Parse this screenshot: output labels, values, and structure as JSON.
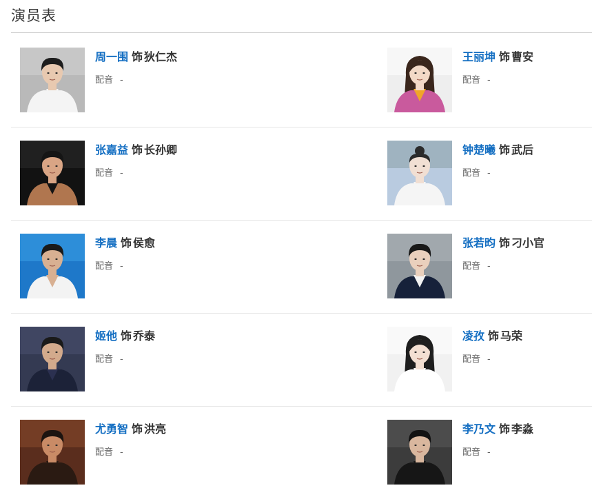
{
  "section": {
    "title": "演员表"
  },
  "cast": [
    {
      "actor": "周一围",
      "connector": "饰",
      "role": "狄仁杰",
      "voice_label": "配音",
      "voice_value": "-",
      "photo": {
        "bg": "#b9b9b9",
        "bg2": "#d3d3d3",
        "skin": "#e8c9b0",
        "hair": "#1d1d1d",
        "outfit": "#f4f4f4",
        "shirt": "#f4f4f4",
        "hair_style": "short"
      }
    },
    {
      "actor": "王丽坤",
      "connector": "饰",
      "role": "曹安",
      "voice_label": "配音",
      "voice_value": "-",
      "photo": {
        "bg": "#eeeeee",
        "bg2": "#ffffff",
        "skin": "#f3d9c7",
        "hair": "#3a261c",
        "outfit": "#c95a9d",
        "shirt": "#f0a52a",
        "hair_style": "long"
      }
    },
    {
      "actor": "张嘉益",
      "connector": "饰",
      "role": "长孙卿",
      "voice_label": "配音",
      "voice_value": "-",
      "photo": {
        "bg": "#121212",
        "bg2": "#2b2b2b",
        "skin": "#d9a585",
        "hair": "#151515",
        "outfit": "#b0764f",
        "shirt": "#141414",
        "hair_style": "short"
      }
    },
    {
      "actor": "钟楚曦",
      "connector": "饰",
      "role": "武后",
      "voice_label": "配音",
      "voice_value": "-",
      "photo": {
        "bg": "#b9cbe0",
        "bg2": "#8aa1a6",
        "skin": "#f1dfd3",
        "hair": "#2b2b2b",
        "outfit": "#f5f5f5",
        "shirt": "#f5f5f5",
        "hair_style": "bun"
      }
    },
    {
      "actor": "李晨",
      "connector": "饰",
      "role": "侯愈",
      "voice_label": "配音",
      "voice_value": "-",
      "photo": {
        "bg": "#1e78c9",
        "bg2": "#3aa0e6",
        "skin": "#d8b092",
        "hair": "#1a1a1a",
        "outfit": "#f3f3f3",
        "shirt": "#d8b092",
        "hair_style": "short"
      }
    },
    {
      "actor": "张若昀",
      "connector": "饰",
      "role": "刁小官",
      "voice_label": "配音",
      "voice_value": "-",
      "photo": {
        "bg": "#8f979d",
        "bg2": "#b0b6ba",
        "skin": "#ead0bd",
        "hair": "#191919",
        "outfit": "#16213a",
        "shirt": "#f3f3f3",
        "hair_style": "short"
      }
    },
    {
      "actor": "姬他",
      "connector": "饰",
      "role": "乔泰",
      "voice_label": "配音",
      "voice_value": "-",
      "photo": {
        "bg": "#343a52",
        "bg2": "#4a5070",
        "skin": "#d3aa8c",
        "hair": "#1a1a1a",
        "outfit": "#1c2238",
        "shirt": "#2b3050",
        "hair_style": "short"
      }
    },
    {
      "actor": "凌孜",
      "connector": "饰",
      "role": "马荣",
      "voice_label": "配音",
      "voice_value": "-",
      "photo": {
        "bg": "#f1f1f1",
        "bg2": "#ffffff",
        "skin": "#f3dfd2",
        "hair": "#1e1e1e",
        "outfit": "#ffffff",
        "shirt": "#ffffff",
        "hair_style": "long"
      }
    },
    {
      "actor": "尤勇智",
      "connector": "饰",
      "role": "洪亮",
      "voice_label": "配音",
      "voice_value": "-",
      "photo": {
        "bg": "#5a2d1d",
        "bg2": "#8a4a2c",
        "skin": "#c98b66",
        "hair": "#1c1410",
        "outfit": "#2a1a12",
        "shirt": "#2a1a12",
        "hair_style": "short"
      }
    },
    {
      "actor": "李乃文",
      "connector": "饰",
      "role": "李淼",
      "voice_label": "配音",
      "voice_value": "-",
      "photo": {
        "bg": "#3c3c3c",
        "bg2": "#5a5a5a",
        "skin": "#d9b79e",
        "hair": "#121212",
        "outfit": "#161616",
        "shirt": "#161616",
        "hair_style": "short"
      }
    }
  ]
}
